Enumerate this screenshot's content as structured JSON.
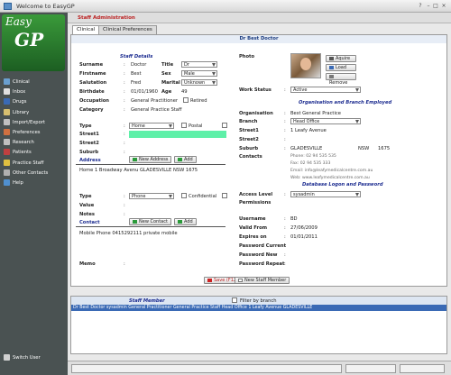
{
  "window": {
    "title": "Welcome to EasyGP",
    "controls": [
      "?",
      "–",
      "□",
      "×"
    ]
  },
  "sidebar": {
    "logo_line1": "Easy",
    "logo_line2": "GP",
    "items": [
      {
        "label": "Clinical",
        "color": "#6aa0d0"
      },
      {
        "label": "Inbox",
        "color": "#e0e0e0"
      },
      {
        "label": "Drugs",
        "color": "#3a6ab5"
      },
      {
        "label": "Library",
        "color": "#d8c070"
      },
      {
        "label": "Import/Export",
        "color": "#c0c0c0"
      },
      {
        "label": "Preferences",
        "color": "#d07040"
      },
      {
        "label": "Research",
        "color": "#c0c0c0"
      },
      {
        "label": "Patients",
        "color": "#c04040"
      },
      {
        "label": "Practice Staff",
        "color": "#e0c040"
      },
      {
        "label": "Other Contacts",
        "color": "#b0b0b0"
      },
      {
        "label": "Help",
        "color": "#5090d0"
      }
    ],
    "switch_user": "Switch User"
  },
  "header": {
    "title": "Staff Administration"
  },
  "tabs": [
    {
      "label": "Clinical"
    },
    {
      "label": "Clinical Preferences"
    }
  ],
  "doctor_name": "Dr Best Doctor",
  "staff_details": {
    "heading": "Staff Details",
    "surname_label": "Surname",
    "surname": "Doctor",
    "title_label": "Title",
    "title": "Dr",
    "firstname_label": "Firstname",
    "firstname": "Best",
    "sex_label": "Sex",
    "sex": "Male",
    "salutation_label": "Salutation",
    "salutation": "Fred",
    "marital_label": "Marital",
    "marital": "Unknown",
    "birthdate_label": "Birthdate",
    "birthdate": "01/01/1960",
    "age_label": "Age",
    "age": "49",
    "occupation_label": "Occupation",
    "occupation": "General Practitioner",
    "retired_label": "Retired",
    "category_label": "Category",
    "category": "General Practice Staff"
  },
  "address": {
    "type_label": "Type",
    "type": "Home",
    "postal_label": "Postal",
    "street1_label": "Street1",
    "street2_label": "Street2",
    "suburb_label": "Suburb",
    "section_label": "Address",
    "new_btn": "New Address",
    "add_btn": "Add",
    "entry": "Home 1 Broadway Avenu GLADESVILLE NSW 1675"
  },
  "contact": {
    "type_label": "Type",
    "type": "Phone",
    "confidential_label": "Confidential",
    "value_label": "Value",
    "notes_label": "Notes",
    "section_label": "Contact",
    "new_btn": "New Contact",
    "add_btn": "Add",
    "entry": "Mobile Phone 0415292111 private mobile"
  },
  "memo_label": "Memo",
  "photo": {
    "label": "Photo",
    "acquire": "Aquire",
    "load": "Load",
    "remove": "Remove"
  },
  "work": {
    "status_label": "Work Status",
    "status": "Active"
  },
  "organisation": {
    "heading": "Organisation and Branch Employed",
    "org_label": "Organisation",
    "org": "Best General Practice",
    "branch_label": "Branch",
    "branch": "Head Office",
    "street1_label": "Street1",
    "street1": "1 Leafy Avenue",
    "street2_label": "Street2",
    "suburb_label": "Suburb",
    "suburb": "GLADESVILLE",
    "state": "NSW",
    "postcode": "1675",
    "contacts_label": "Contacts",
    "contacts": [
      "Phone: 02 94 535 535",
      "Fax: 02 94 535 333",
      "Email: info@leafymedicalcentre.com.au",
      "Web: www.leafymedicalcentre.com.au"
    ]
  },
  "database": {
    "heading": "Database Logon and Password",
    "access_label": "Access Level",
    "access": "sysadmin",
    "permissions_label": "Permissions",
    "username_label": "Username",
    "username": "BD",
    "valid_label": "Valid From",
    "valid": "27/06/2009",
    "expires_label": "Expires on",
    "expires": "01/01/2011",
    "pwd_current_label": "Password Current",
    "pwd_new_label": "Password New",
    "pwd_repeat_label": "Password Repeat"
  },
  "actions": {
    "save": "Save (F12)",
    "new_staff": "New Staff Member"
  },
  "staff_list": {
    "heading": "Staff Member",
    "filter_label": "Filter by branch",
    "rows": [
      "Dr Best Doctor sysadmin General Practitioner General Practice Staff Head Office 1 Leafy Avenue GLADESVILLE"
    ]
  }
}
